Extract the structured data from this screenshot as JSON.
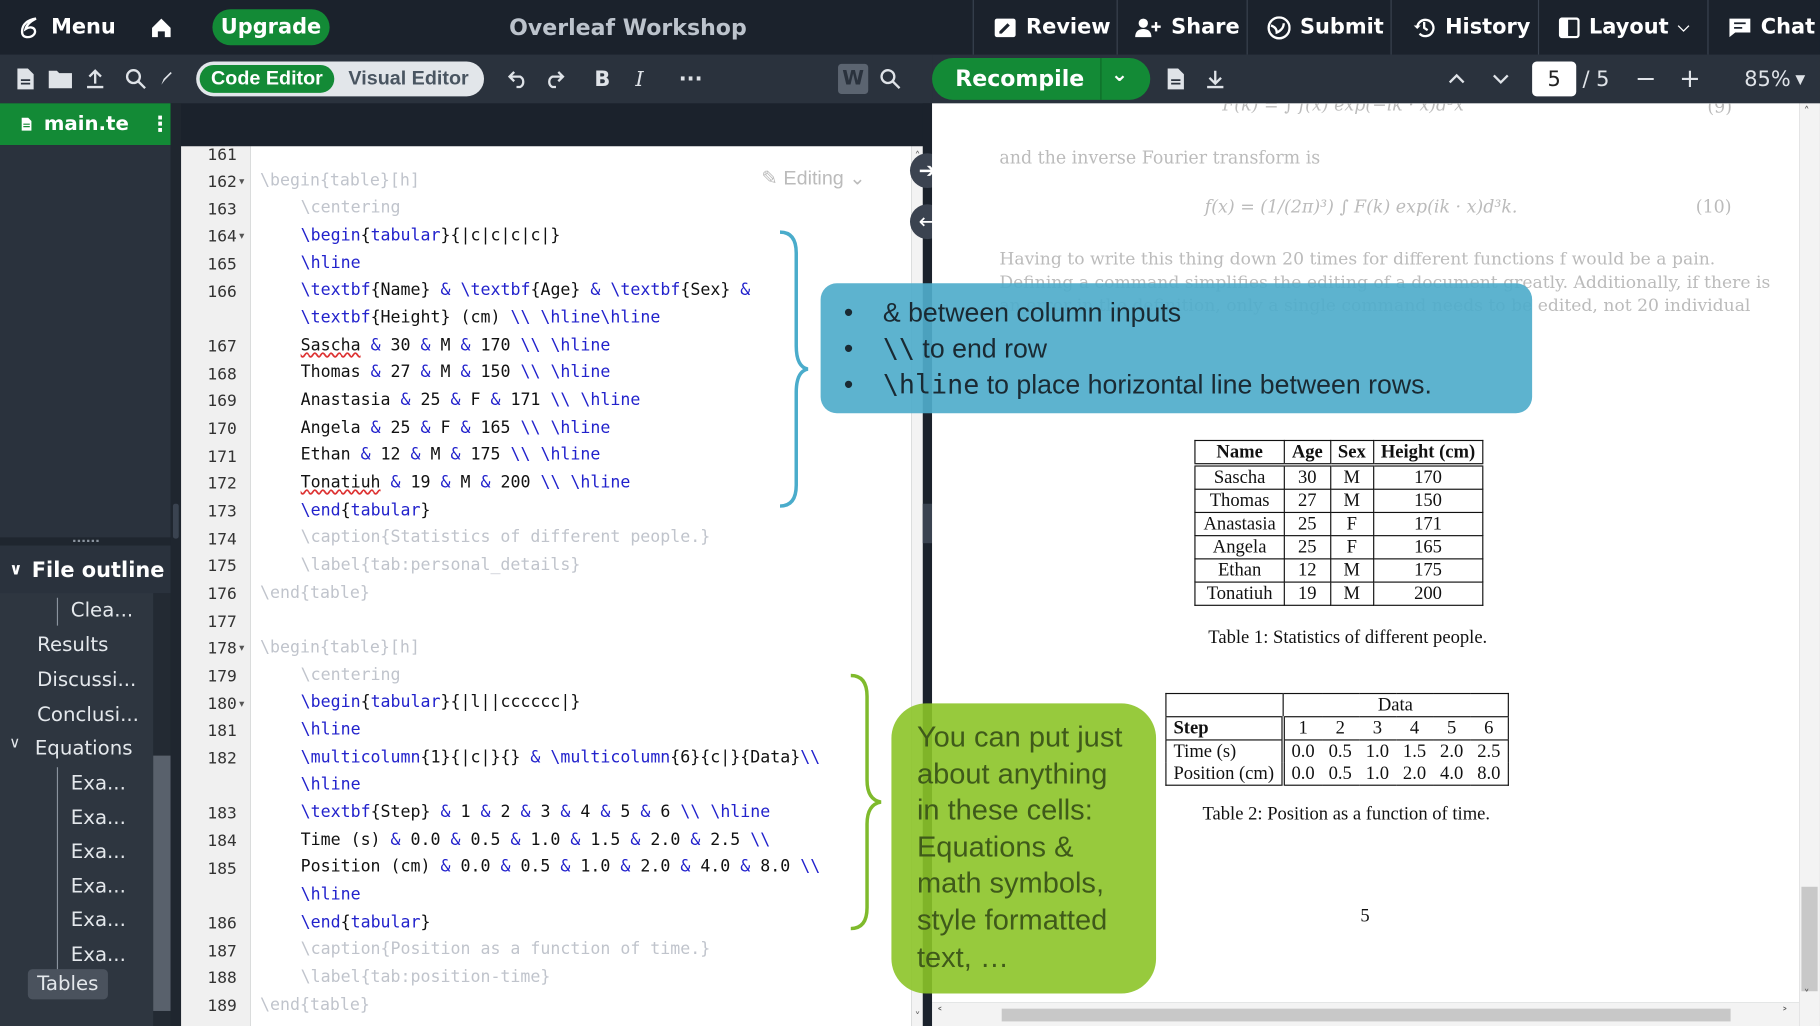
{
  "topbar": {
    "menu_label": "Menu",
    "upgrade_label": "Upgrade",
    "project_title": "Overleaf Workshop",
    "review_label": "Review",
    "share_label": "Share",
    "submit_label": "Submit",
    "history_label": "History",
    "layout_label": "Layout",
    "chat_label": "Chat"
  },
  "toolbar": {
    "code_editor_label": "Code Editor",
    "visual_editor_label": "Visual Editor",
    "bold_label": "B",
    "italic_label": "I",
    "more_label": "···"
  },
  "pdf_toolbar": {
    "recompile_label": "Recompile",
    "page_current": "5",
    "page_total": "/ 5",
    "zoom": "85%"
  },
  "file_tab": {
    "name": "main.te"
  },
  "outline": {
    "title": "File outline",
    "items": [
      "Clea...",
      "Results",
      "Discussi...",
      "Conclusi...",
      "Equations",
      "Exa...",
      "Exa...",
      "Exa...",
      "Exa...",
      "Exa...",
      "Exa...",
      "Tables"
    ]
  },
  "editor": {
    "editing_label": "Editing",
    "line_numbers": [
      "161",
      "162",
      "163",
      "164",
      "165",
      "166",
      "",
      "167",
      "168",
      "169",
      "170",
      "171",
      "172",
      "173",
      "174",
      "175",
      "176",
      "177",
      "178",
      "179",
      "180",
      "181",
      "182",
      "",
      "183",
      "184",
      "185",
      "",
      "186",
      "187",
      "188",
      "189"
    ]
  },
  "callouts": {
    "blue": [
      {
        "code": "&",
        "text": " between column inputs"
      },
      {
        "code": "\\\\",
        "text": " to end row"
      },
      {
        "code": "\\hline",
        "text": " to place horizontal line between rows."
      }
    ],
    "green": "You can put just about anything in these cells: Equations & math symbols, style formatted text, …"
  },
  "pdf": {
    "faded_text_1": "and the inverse Fourier transform is",
    "faded_eq_number": "(10)",
    "faded_eq_top_number": "(9)",
    "faded_para_1": "Having to write this thing down 20 times for different functions f would be a pain.",
    "faded_para_2": "Defining a command simplifies the editing of a document greatly. Additionally, if there is",
    "faded_para_3": "an error in the definition, only a single command needs to be edited, not 20 individual",
    "table1": {
      "headers": [
        "Name",
        "Age",
        "Sex",
        "Height (cm)"
      ],
      "rows": [
        [
          "Sascha",
          "30",
          "M",
          "170"
        ],
        [
          "Thomas",
          "27",
          "M",
          "150"
        ],
        [
          "Anastasia",
          "25",
          "F",
          "171"
        ],
        [
          "Angela",
          "25",
          "F",
          "165"
        ],
        [
          "Ethan",
          "12",
          "M",
          "175"
        ],
        [
          "Tonatiuh",
          "19",
          "M",
          "200"
        ]
      ],
      "caption": "Table 1: Statistics of different people."
    },
    "table2": {
      "group_header": "Data",
      "step_label": "Step",
      "steps": [
        "1",
        "2",
        "3",
        "4",
        "5",
        "6"
      ],
      "time_label": "Time (s)",
      "time": [
        "0.0",
        "0.5",
        "1.0",
        "1.5",
        "2.0",
        "2.5"
      ],
      "position_label": "Position (cm)",
      "position": [
        "0.0",
        "0.5",
        "1.0",
        "2.0",
        "4.0",
        "8.0"
      ],
      "caption": "Table 2: Position as a function of time."
    },
    "page_number": "5"
  }
}
